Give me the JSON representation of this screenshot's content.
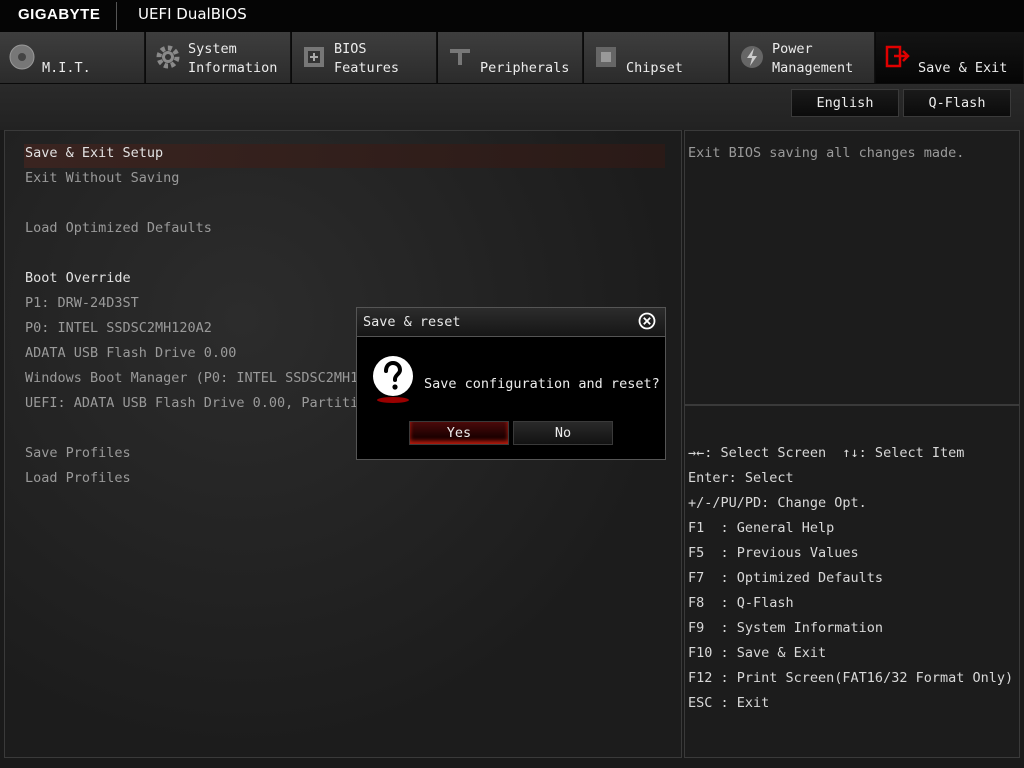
{
  "app": {
    "brand": "GIGABYTE",
    "product": "UEFI DualBIOS"
  },
  "tabs": [
    {
      "label": "M.I.T.",
      "icon": "gauge-icon"
    },
    {
      "label": "System\nInformation",
      "icon": "gear-icon"
    },
    {
      "label": "BIOS\nFeatures",
      "icon": "chip-plus-icon"
    },
    {
      "label": "Peripherals",
      "icon": "connector-icon"
    },
    {
      "label": "Chipset",
      "icon": "chipset-icon"
    },
    {
      "label": "Power\nManagement",
      "icon": "power-bolt-icon"
    },
    {
      "label": "Save & Exit",
      "icon": "exit-door-icon",
      "active": true
    }
  ],
  "toolbar": {
    "language": "English",
    "qflash": "Q-Flash"
  },
  "menu": {
    "items": [
      "Save & Exit Setup",
      "Exit Without Saving",
      "Load Optimized Defaults",
      "Boot Override",
      "P1: DRW-24D3ST",
      "P0: INTEL SSDSC2MH120A2",
      "ADATA USB Flash Drive 0.00",
      "Windows Boot Manager (P0: INTEL SSDSC2MH12",
      "UEFI: ADATA USB Flash Drive 0.00, Partitio",
      "Save Profiles",
      "Load Profiles"
    ],
    "selected": "Save & Exit Setup"
  },
  "help": {
    "text": "Exit BIOS saving all changes made."
  },
  "keys": [
    "→←: Select Screen  ↑↓: Select Item",
    "Enter: Select",
    "+/-/PU/PD: Change Opt.",
    "F1  : General Help",
    "F5  : Previous Values",
    "F7  : Optimized Defaults",
    "F8  : Q-Flash",
    "F9  : System Information",
    "F10 : Save & Exit",
    "F12 : Print Screen(FAT16/32 Format Only)",
    "ESC : Exit"
  ],
  "dialog": {
    "title": "Save & reset",
    "message": "Save configuration and reset?",
    "yes": "Yes",
    "no": "No"
  },
  "colors": {
    "accent": "#e00000",
    "background": "#1a1a1a",
    "selection": "#3a2420"
  }
}
